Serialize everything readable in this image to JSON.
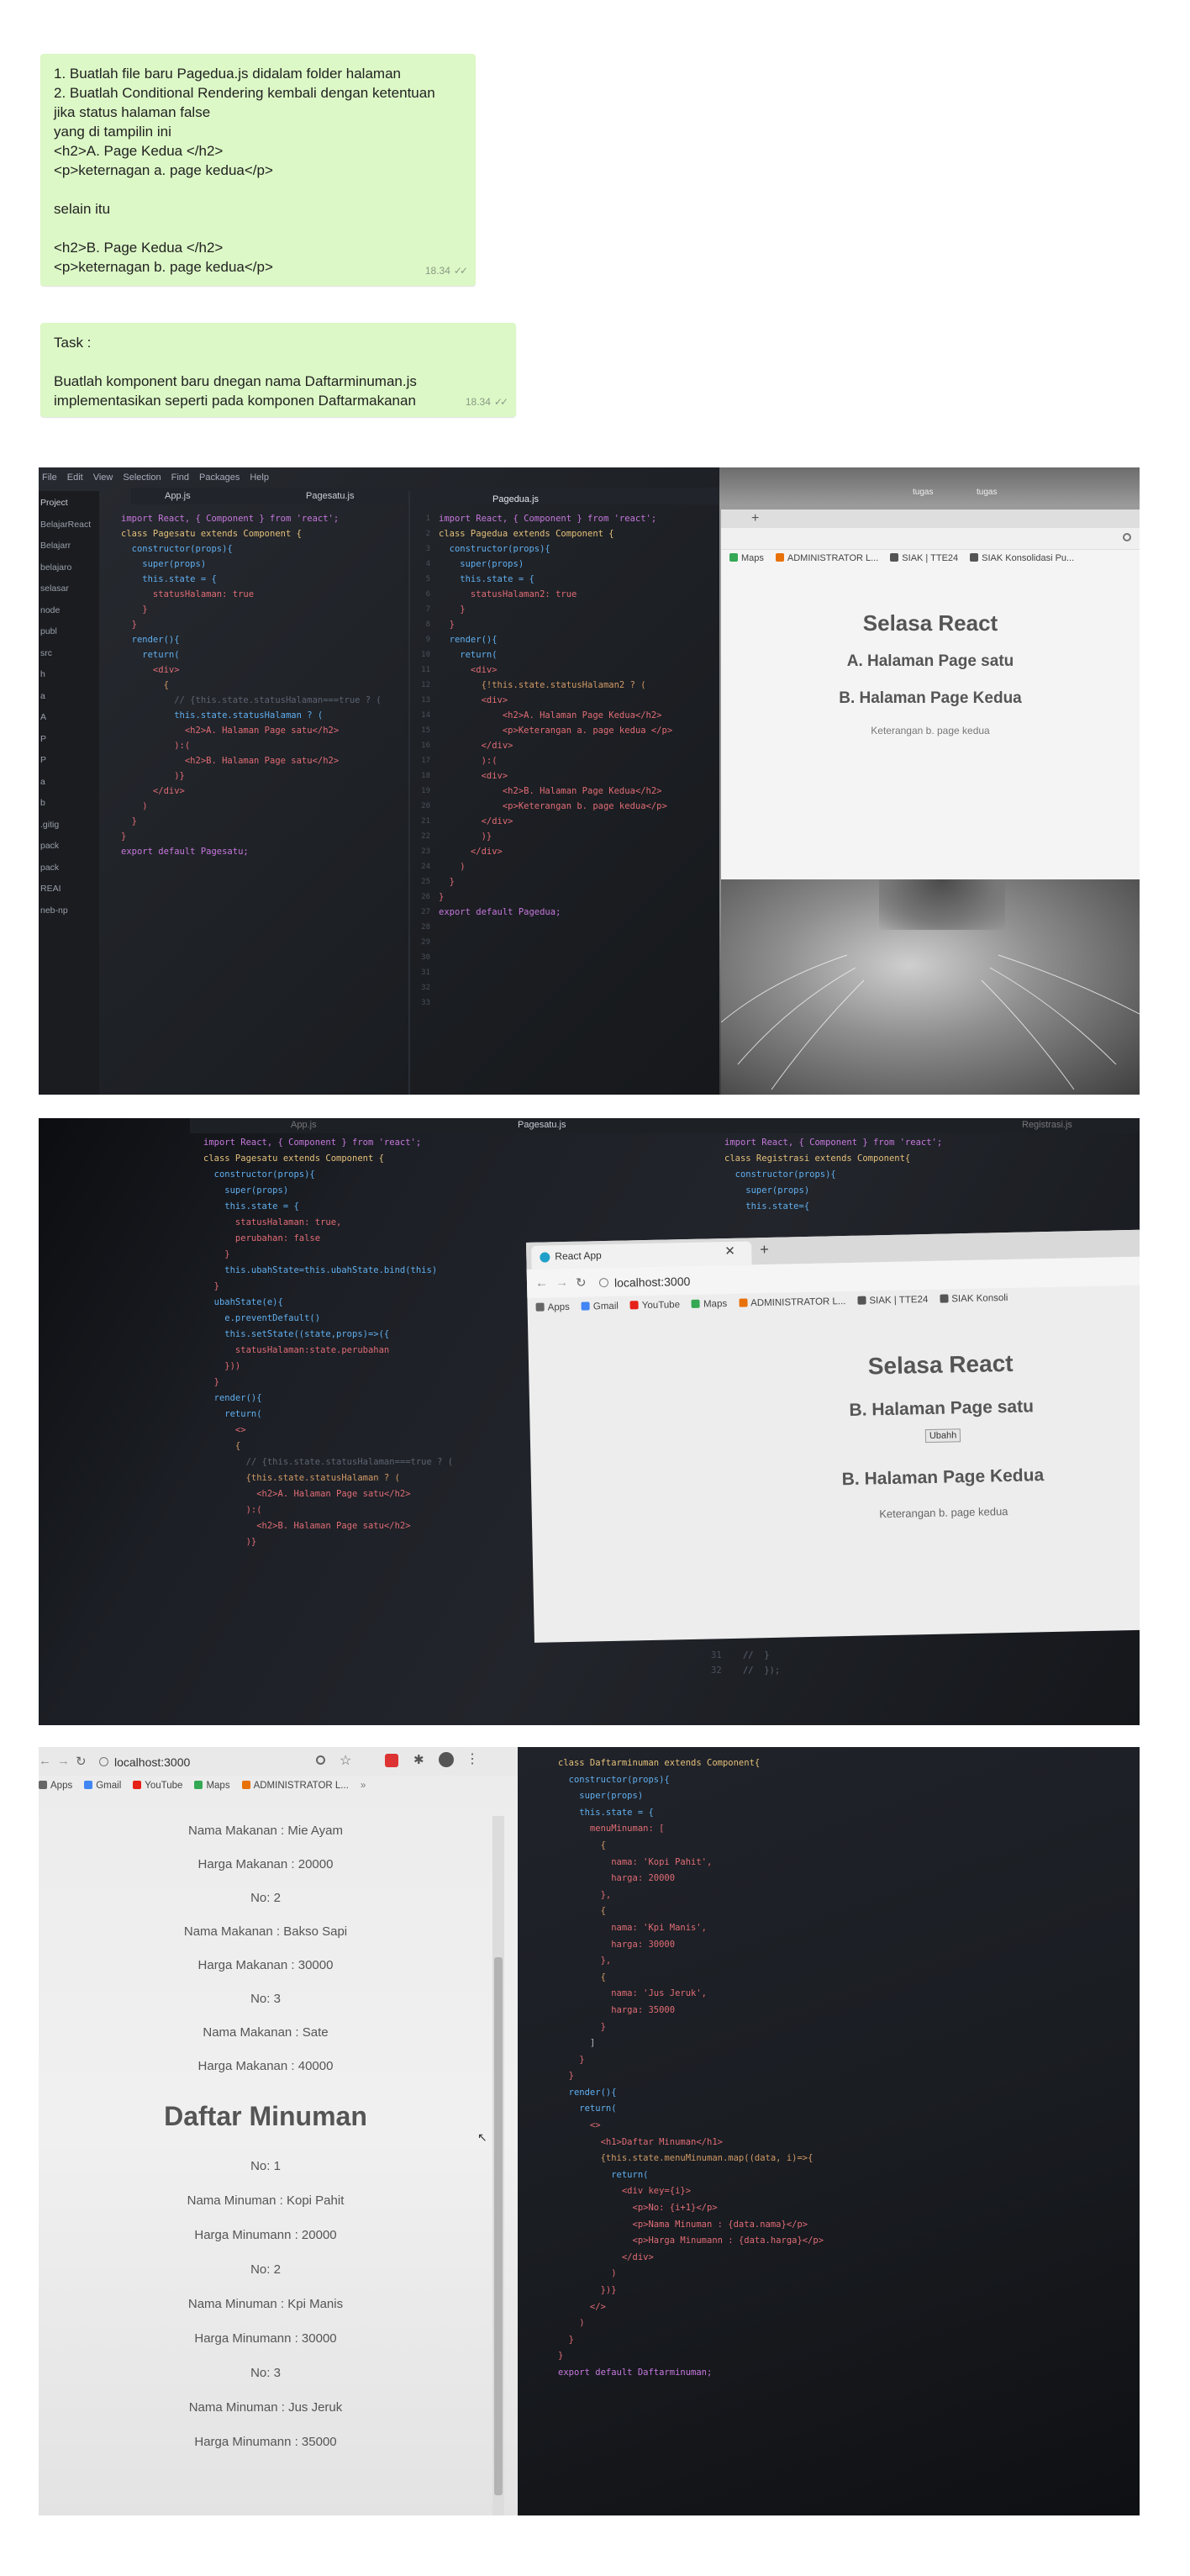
{
  "chat": {
    "message1": {
      "lines": [
        "1. Buatlah file baru Pagedua.js didalam folder halaman",
        "2. Buatlah Conditional Rendering kembali dengan ketentuan",
        "jika status halaman false",
        "yang di tampilin ini",
        "<h2>A. Page Kedua </h2>",
        "<p>keternagan a. page kedua</p>",
        "",
        "selain itu",
        "",
        "<h2>B. Page Kedua </h2>",
        "<p>keternagan b. page kedua</p>"
      ],
      "time": "18.34"
    },
    "message2": {
      "lines": [
        "Task :",
        "",
        "Buatlah komponent baru dnegan nama Daftarminuman.js",
        "implementasikan seperti pada komponen Daftarmakanan"
      ],
      "time": "18.34"
    },
    "tick_icon": "double-check-icon"
  },
  "photo1": {
    "menu": [
      "File",
      "Edit",
      "View",
      "Selection",
      "Find",
      "Packages",
      "Help"
    ],
    "tabs": [
      "App.js",
      "Pagesatu.js",
      "Pagedua.js"
    ],
    "tree": [
      "Project",
      "BelajarReact",
      "Belajarr",
      "belajaro",
      "selasar",
      "node",
      "publ",
      "src",
      "h",
      "a",
      "A",
      "P",
      "P",
      "a",
      "b",
      ".gitig",
      "pack",
      "pack",
      "REAI",
      "neb-np"
    ],
    "left_code": [
      "import React, { Component } from 'react';",
      "",
      "class Pagesatu extends Component {",
      "  constructor(props){",
      "    super(props)",
      "    this.state = {",
      "      statusHalaman: true",
      "    }",
      "  }",
      "",
      "  render(){",
      "    return(",
      "      <div>",
      "        {",
      "          // {this.state.statusHalaman===true ? (",
      "",
      "          this.state.statusHalaman ? (",
      "            <h2>A. Halaman Page satu</h2>",
      "          ):(",
      "            <h2>B. Halaman Page satu</h2>",
      "          )}",
      "      </div>",
      "    )",
      "  }",
      "}",
      "",
      "export default Pagesatu;"
    ],
    "right_code": [
      "import React, { Component } from 'react';",
      "",
      "class Pagedua extends Component {",
      "  constructor(props){",
      "    super(props)",
      "    this.state = {",
      "      statusHalaman2: true",
      "    }",
      "  }",
      "",
      "  render(){",
      "    return(",
      "      <div>",
      "        {!this.state.statusHalaman2 ? (",
      "        <div>",
      "            <h2>A. Halaman Page Kedua</h2>",
      "            <p>Keterangan a. page kedua </p>",
      "        </div>",
      "        ):(",
      "        <div>",
      "            <h2>B. Halaman Page Kedua</h2>",
      "            <p>Keterangan b. page kedua</p>",
      "        </div>",
      "        )}",
      "      </div>",
      "    )",
      "  }",
      "}",
      "",
      "",
      "",
      "export default Pagedua;",
      ""
    ],
    "desktop_icons": [
      "tugas",
      "tugas"
    ],
    "bookmarks": [
      "Maps",
      "ADMINISTRATOR L...",
      "SIAK | TTE24",
      "SIAK Konsolidasi Pu..."
    ],
    "page": {
      "title": "Selasa React",
      "h2a": "A. Halaman Page satu",
      "h2b": "B. Halaman Page Kedua",
      "p": "Keterangan b. page kedua"
    }
  },
  "photo2": {
    "tabs": [
      "App.js",
      "Pagesatu.js",
      "Registrasi.js"
    ],
    "left_code": [
      "import React, { Component } from 'react';",
      "",
      "class Pagesatu extends Component {",
      "  constructor(props){",
      "    super(props)",
      "    this.state = {",
      "      statusHalaman: true,",
      "      perubahan: false",
      "    }",
      "    this.ubahState=this.ubahState.bind(this)",
      "  }",
      "",
      "",
      "",
      "  ubahState(e){",
      "    e.preventDefault()",
      "",
      "    this.setState((state,props)=>({",
      "      statusHalaman:state.perubahan",
      "    }))",
      "",
      "",
      "  }",
      "",
      "  render(){",
      "    return(",
      "      <>",
      "      {",
      "        // {this.state.statusHalaman===true ? (",
      "",
      "        {this.state.statusHalaman ? (",
      "          <h2>A. Halaman Page satu</h2>",
      "        ):(",
      "          <h2>B. Halaman Page satu</h2>",
      "        )}"
    ],
    "right_code": [
      "import React, { Component } from 'react';",
      "",
      "class Registrasi extends Component{",
      "  constructor(props){",
      "    super(props)",
      "    this.state={"
    ],
    "browser": {
      "tab_title": "React App",
      "url": "localhost:3000",
      "bookmarks": [
        "Apps",
        "Gmail",
        "YouTube",
        "Maps",
        "ADMINISTRATOR L...",
        "SIAK | TTE24",
        "SIAK Konsoli"
      ]
    },
    "page": {
      "title": "Selasa React",
      "h2a": "B. Halaman Page satu",
      "button": "Ubahh",
      "h2b": "B. Halaman Page Kedua",
      "p": "Keterangan b. page kedua"
    },
    "trailing_lines": [
      "31",
      "32",
      "//  }",
      "//  });"
    ]
  },
  "photo3": {
    "browser": {
      "url": "localhost:3000",
      "bookmarks": [
        "Apps",
        "Gmail",
        "YouTube",
        "Maps",
        "ADMINISTRATOR L..."
      ]
    },
    "makanan_rows": [
      "Nama Makanan : Mie Ayam",
      "Harga Makanan : 20000",
      "No: 2",
      "Nama Makanan : Bakso Sapi",
      "Harga Makanan : 30000",
      "No: 3",
      "Nama Makanan : Sate",
      "Harga Makanan : 40000"
    ],
    "minuman_title": "Daftar Minuman",
    "minuman_rows": [
      "No: 1",
      "Nama Minuman : Kopi Pahit",
      "Harga Minumann : 20000",
      "No: 2",
      "Nama Minuman : Kpi Manis",
      "Harga Minumann : 30000",
      "No: 3",
      "Nama Minuman : Jus Jeruk",
      "Harga Minumann : 35000"
    ],
    "code": [
      "class Daftarminuman extends Component{",
      "  constructor(props){",
      "    super(props)",
      "    this.state = {",
      "      menuMinuman: [",
      "        {",
      "          nama: 'Kopi Pahit',",
      "          harga: 20000",
      "        },",
      "        {",
      "          nama: 'Kpi Manis',",
      "          harga: 30000",
      "        },",
      "        {",
      "          nama: 'Jus Jeruk',",
      "          harga: 35000",
      "        }",
      "      ]",
      "    }",
      "  }",
      "",
      "  render(){",
      "    return(",
      "      <>",
      "        <h1>Daftar Minuman</h1>",
      "        {this.state.menuMinuman.map((data, i)=>{",
      "",
      "          return(",
      "            <div key={i}>",
      "              <p>No: {i+1}</p>",
      "              <p>Nama Minuman : {data.nama}</p>",
      "              <p>Harga Minumann : {data.harga}</p>",
      "            </div>",
      "          )",
      "        })}",
      "      </>",
      "    )",
      "  }",
      "}",
      "",
      "export default Daftarminuman;"
    ]
  }
}
